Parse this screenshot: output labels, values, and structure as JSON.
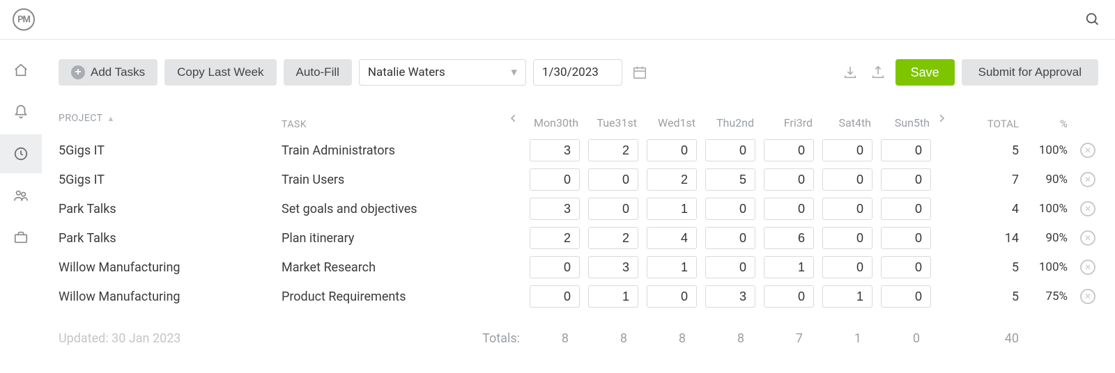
{
  "logo_text": "PM",
  "toolbar": {
    "add_tasks": "Add Tasks",
    "copy_last_week": "Copy Last Week",
    "auto_fill": "Auto-Fill",
    "user": "Natalie Waters",
    "date": "1/30/2023",
    "save": "Save",
    "submit": "Submit for Approval"
  },
  "headers": {
    "project": "PROJECT",
    "task": "TASK",
    "total": "TOTAL",
    "pct": "%"
  },
  "days": [
    {
      "dow": "Mon",
      "label": "30th"
    },
    {
      "dow": "Tue",
      "label": "31st"
    },
    {
      "dow": "Wed",
      "label": "1st"
    },
    {
      "dow": "Thu",
      "label": "2nd"
    },
    {
      "dow": "Fri",
      "label": "3rd"
    },
    {
      "dow": "Sat",
      "label": "4th"
    },
    {
      "dow": "Sun",
      "label": "5th"
    }
  ],
  "rows": [
    {
      "project": "5Gigs IT",
      "task": "Train Administrators",
      "hours": [
        "3",
        "2",
        "0",
        "0",
        "0",
        "0",
        "0"
      ],
      "total": "5",
      "pct": "100%"
    },
    {
      "project": "5Gigs IT",
      "task": "Train Users",
      "hours": [
        "0",
        "0",
        "2",
        "5",
        "0",
        "0",
        "0"
      ],
      "total": "7",
      "pct": "90%"
    },
    {
      "project": "Park Talks",
      "task": "Set goals and objectives",
      "hours": [
        "3",
        "0",
        "1",
        "0",
        "0",
        "0",
        "0"
      ],
      "total": "4",
      "pct": "100%"
    },
    {
      "project": "Park Talks",
      "task": "Plan itinerary",
      "hours": [
        "2",
        "2",
        "4",
        "0",
        "6",
        "0",
        "0"
      ],
      "total": "14",
      "pct": "90%"
    },
    {
      "project": "Willow Manufacturing",
      "task": "Market Research",
      "hours": [
        "0",
        "3",
        "1",
        "0",
        "1",
        "0",
        "0"
      ],
      "total": "5",
      "pct": "100%"
    },
    {
      "project": "Willow Manufacturing",
      "task": "Product Requirements",
      "hours": [
        "0",
        "1",
        "0",
        "3",
        "0",
        "1",
        "0"
      ],
      "total": "5",
      "pct": "75%"
    }
  ],
  "footer": {
    "updated": "Updated: 30 Jan 2023",
    "label": "Totals:",
    "day_totals": [
      "8",
      "8",
      "8",
      "8",
      "7",
      "1",
      "0"
    ],
    "grand_total": "40"
  }
}
